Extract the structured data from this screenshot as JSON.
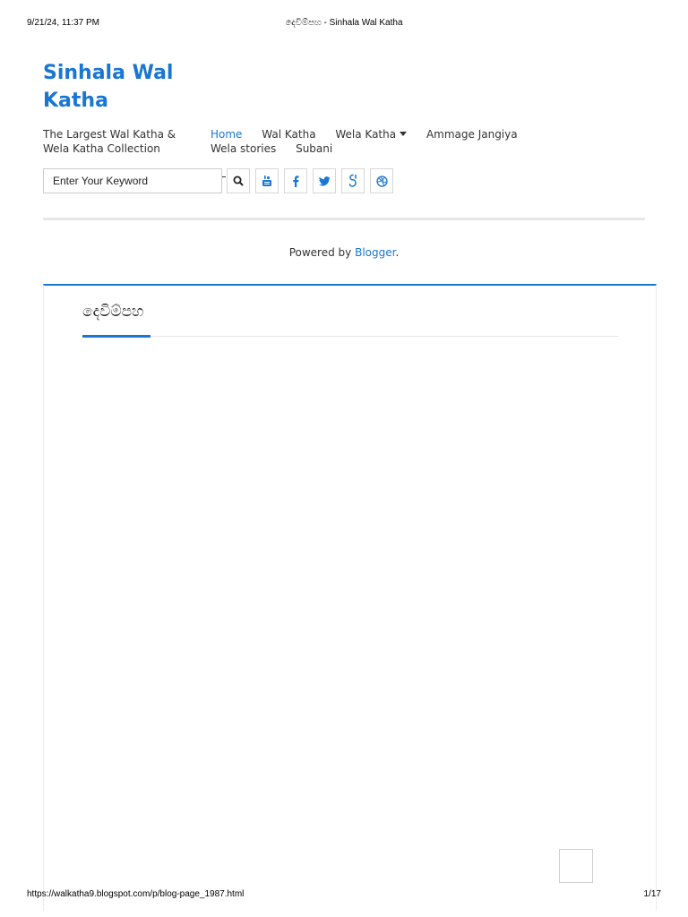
{
  "print": {
    "datetime": "9/21/24, 11:37 PM",
    "doc_title": "දෙවිම්පහ - Sinhala Wal Katha",
    "url": "https://walkatha9.blogspot.com/p/blog-page_1987.html",
    "page": "1/17"
  },
  "header": {
    "site_title": "Sinhala Wal Katha",
    "tagline": "The Largest Wal Katha & Wela Katha Collection"
  },
  "nav": {
    "items": [
      {
        "label": "Home"
      },
      {
        "label": "Wal Katha"
      },
      {
        "label": "Wela Katha"
      },
      {
        "label": "Ammage Jangiya"
      },
      {
        "label": "Wela stories"
      },
      {
        "label": "Subani"
      }
    ]
  },
  "search": {
    "placeholder": "Enter Your Keyword"
  },
  "social": {
    "icons": [
      "search-icon",
      "youtube-icon",
      "facebook-icon",
      "twitter-icon",
      "google-plus-icon",
      "dribbble-icon"
    ],
    "icon_color": "#1976d2"
  },
  "footer_note": {
    "prefix": "Powered by",
    "link": "Blogger",
    "suffix": "."
  },
  "post": {
    "title": "දෙවිම්පහ"
  },
  "colors": {
    "accent": "#1976d2",
    "text": "#333333",
    "divider": "#e6e6e6"
  }
}
